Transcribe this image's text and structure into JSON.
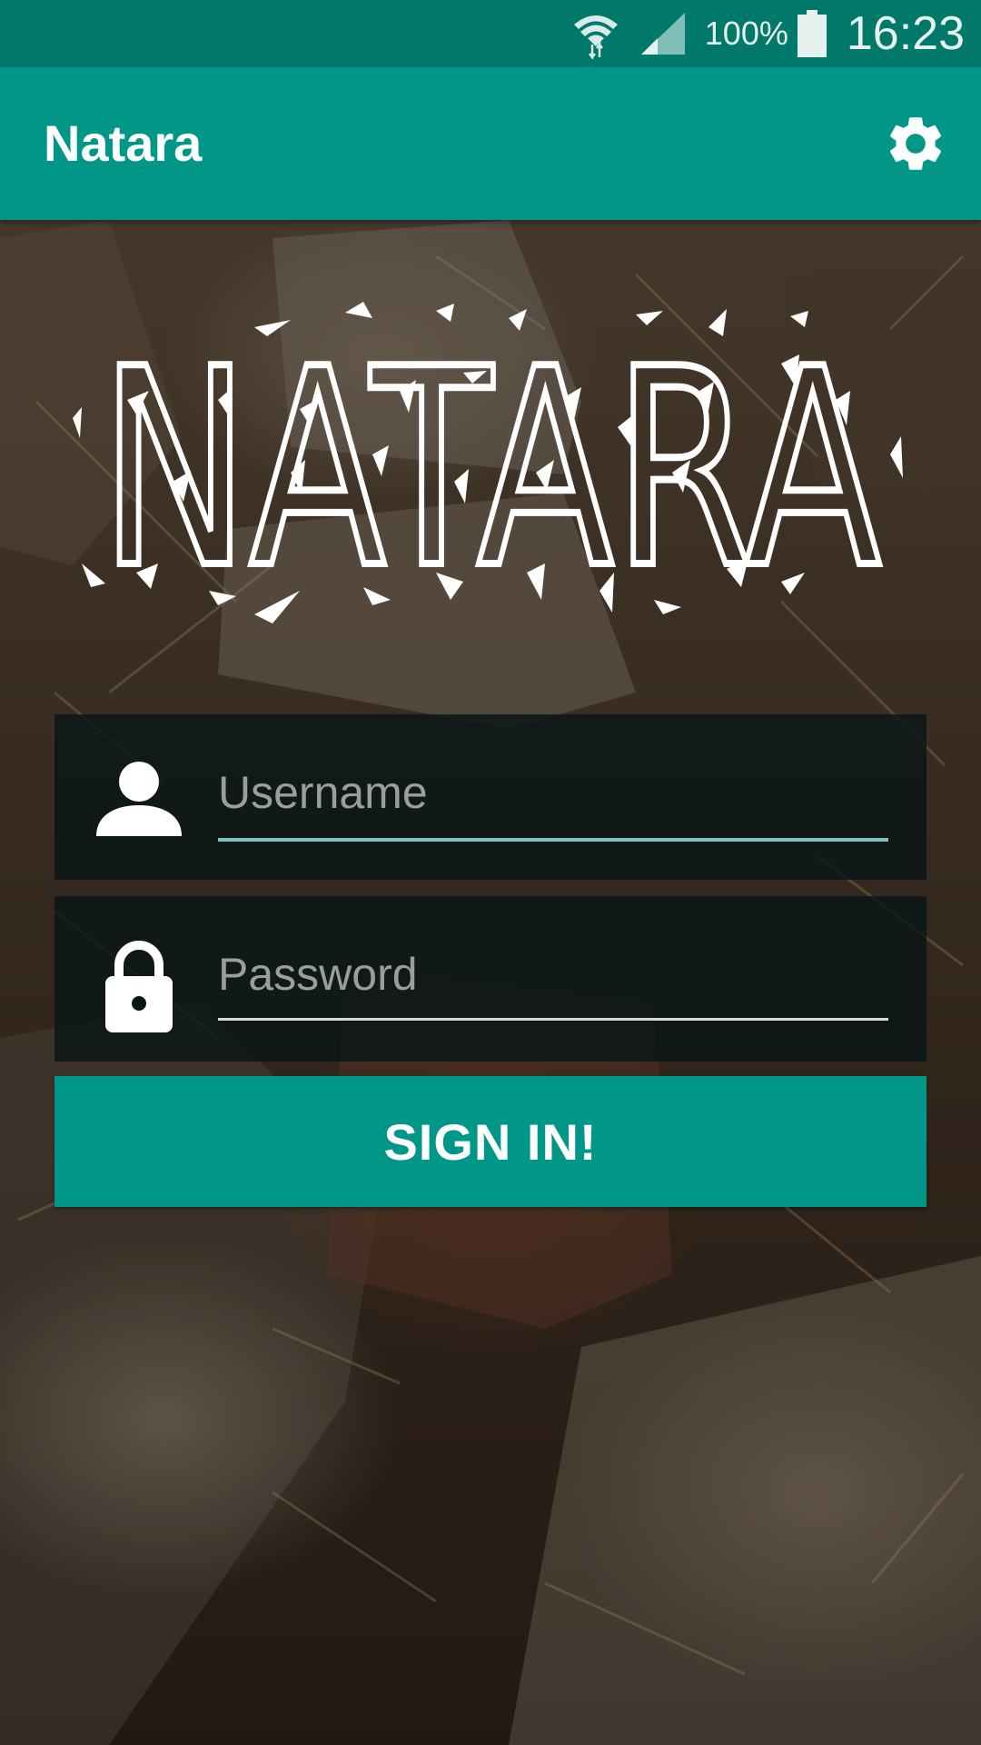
{
  "status_bar": {
    "battery_percent": "100%",
    "time": "16:23",
    "icons": [
      "wifi-icon",
      "signal-icon",
      "battery-icon"
    ]
  },
  "app_bar": {
    "title": "Natara",
    "settings_icon": "gear-icon"
  },
  "logo": {
    "text": "NATARA"
  },
  "form": {
    "username_placeholder": "Username",
    "username_value": "",
    "username_icon": "person-icon",
    "password_placeholder": "Password",
    "password_value": "",
    "password_icon": "lock-icon",
    "submit_label": "SIGN IN!"
  },
  "colors": {
    "primary": "#009688",
    "primary_dark": "#00796b",
    "text_on_primary": "#ffffff",
    "field_background": "#081616"
  }
}
